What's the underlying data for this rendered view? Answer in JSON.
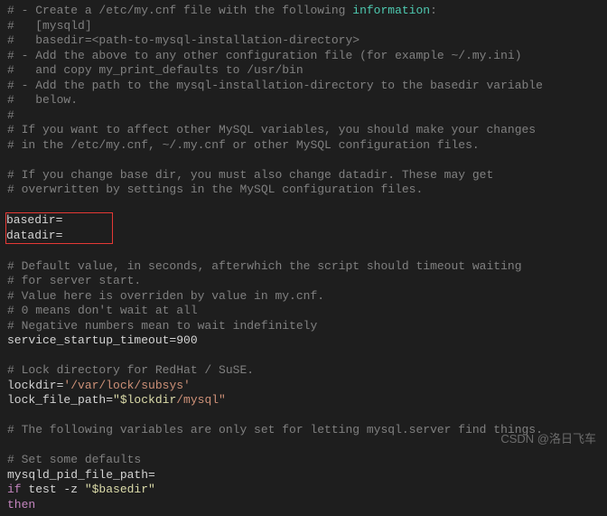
{
  "lines": {
    "l1a": "# - Create a /etc/my.cnf file with the following ",
    "l1b": "information",
    "l1c": ":",
    "l2": "#   [mysqld]",
    "l3": "#   basedir=<path-to-mysql-installation-directory>",
    "l4": "# - Add the above to any other configuration file (for example ~/.my.ini)",
    "l5": "#   and copy my_print_defaults to /usr/bin",
    "l6": "# - Add the path to the mysql-installation-directory to the basedir variable",
    "l7": "#   below.",
    "l8": "#",
    "l9": "# If you want to affect other MySQL variables, you should make your changes",
    "l10": "# in the /etc/my.cnf, ~/.my.cnf or other MySQL configuration files.",
    "l11": "# If you change base dir, you must also change datadir. These may get",
    "l12": "# overwritten by settings in the MySQL configuration files.",
    "box1": "basedir=",
    "box2": "datadir=",
    "l13": "# Default value, in seconds, afterwhich the script should timeout waiting",
    "l14": "# for server start.",
    "l15": "# Value here is overriden by value in my.cnf.",
    "l16": "# 0 means don't wait at all",
    "l17": "# Negative numbers mean to wait indefinitely",
    "l18": "service_startup_timeout=900",
    "l19": "# Lock directory for RedHat / SuSE.",
    "l20a": "lockdir=",
    "l20b": "'/var/lock/subsys'",
    "l21a": "lock_file_path=",
    "l21b": "\"$lockdir",
    "l21c": "/mysql\"",
    "l22": "# The following variables are only set for letting mysql.server find things.",
    "l23": "# Set some defaults",
    "l24": "mysqld_pid_file_path=",
    "l25a": "if",
    "l25b": " test -z ",
    "l25c": "\"$basedir\"",
    "l26": "then"
  },
  "watermark": "CSDN @洛日飞车"
}
